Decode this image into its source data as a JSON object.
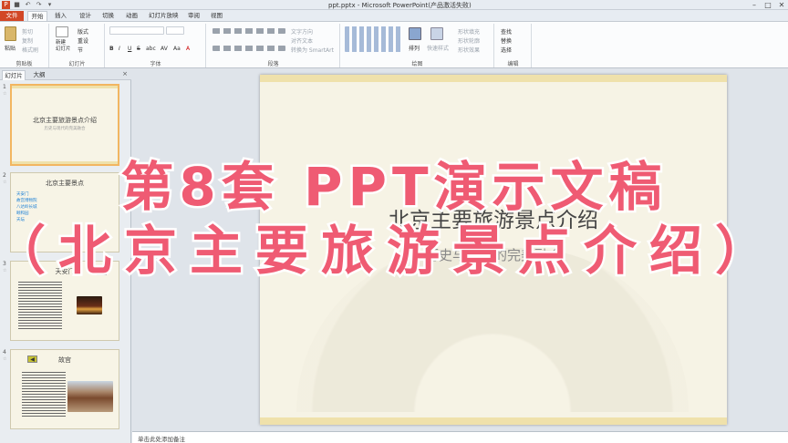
{
  "window": {
    "title": "ppt.pptx - Microsoft PowerPoint(产品激活失败)"
  },
  "ribbon_tabs": [
    "文件",
    "开始",
    "插入",
    "设计",
    "切换",
    "动画",
    "幻灯片放映",
    "审阅",
    "视图"
  ],
  "ribbon": {
    "clipboard": {
      "paste": "粘贴",
      "cut": "剪切",
      "copy": "复制",
      "format_painter": "格式刷",
      "label": "剪贴板"
    },
    "slides": {
      "new_slide": "新建\n幻灯片",
      "layout": "版式",
      "reset": "重设",
      "section": "节",
      "label": "幻灯片"
    },
    "font": {
      "label": "字体",
      "bold": "B",
      "italic": "I",
      "underline": "U",
      "strike": "S",
      "shadow": "abc",
      "spacing": "AV",
      "case": "Aa",
      "color": "A"
    },
    "paragraph": {
      "label": "段落",
      "text_direction": "文字方向",
      "align_text": "对齐文本",
      "smartart": "转换为 SmartArt"
    },
    "drawing": {
      "label": "绘图",
      "arrange": "排列",
      "quick_styles": "快速样式",
      "shape_fill": "形状填充",
      "shape_outline": "形状轮廓",
      "shape_effects": "形状效果"
    },
    "editing": {
      "label": "编辑",
      "find": "查找",
      "replace": "替换",
      "select": "选择"
    }
  },
  "panel": {
    "tabs": [
      "幻灯片",
      "大纲"
    ],
    "close": "×"
  },
  "thumbnails": [
    {
      "num": "1",
      "title": "北京主要旅游景点介绍",
      "subtitle": "历史与现代的完美融合"
    },
    {
      "num": "2",
      "title": "北京主要景点",
      "bullets": [
        "天安门",
        "故宫博物院",
        "八达岭长城",
        "颐和园",
        "天坛"
      ]
    },
    {
      "num": "3",
      "title": "天安门"
    },
    {
      "num": "4",
      "title": "故宫"
    }
  ],
  "slide": {
    "title": "北京主要旅游景点介绍",
    "subtitle": "历史与现代的完美融合"
  },
  "notes": {
    "placeholder": "单击此处添加备注"
  },
  "overlay": {
    "line1": "第8套 PPT演示文稿",
    "line2": "（北京主要旅游景点介绍）",
    "color": "#ef5b73"
  },
  "colors": {
    "file_tab": "#d24726",
    "slide_bg": "#f6f3e5",
    "accent_gold": "#efe1ab"
  }
}
